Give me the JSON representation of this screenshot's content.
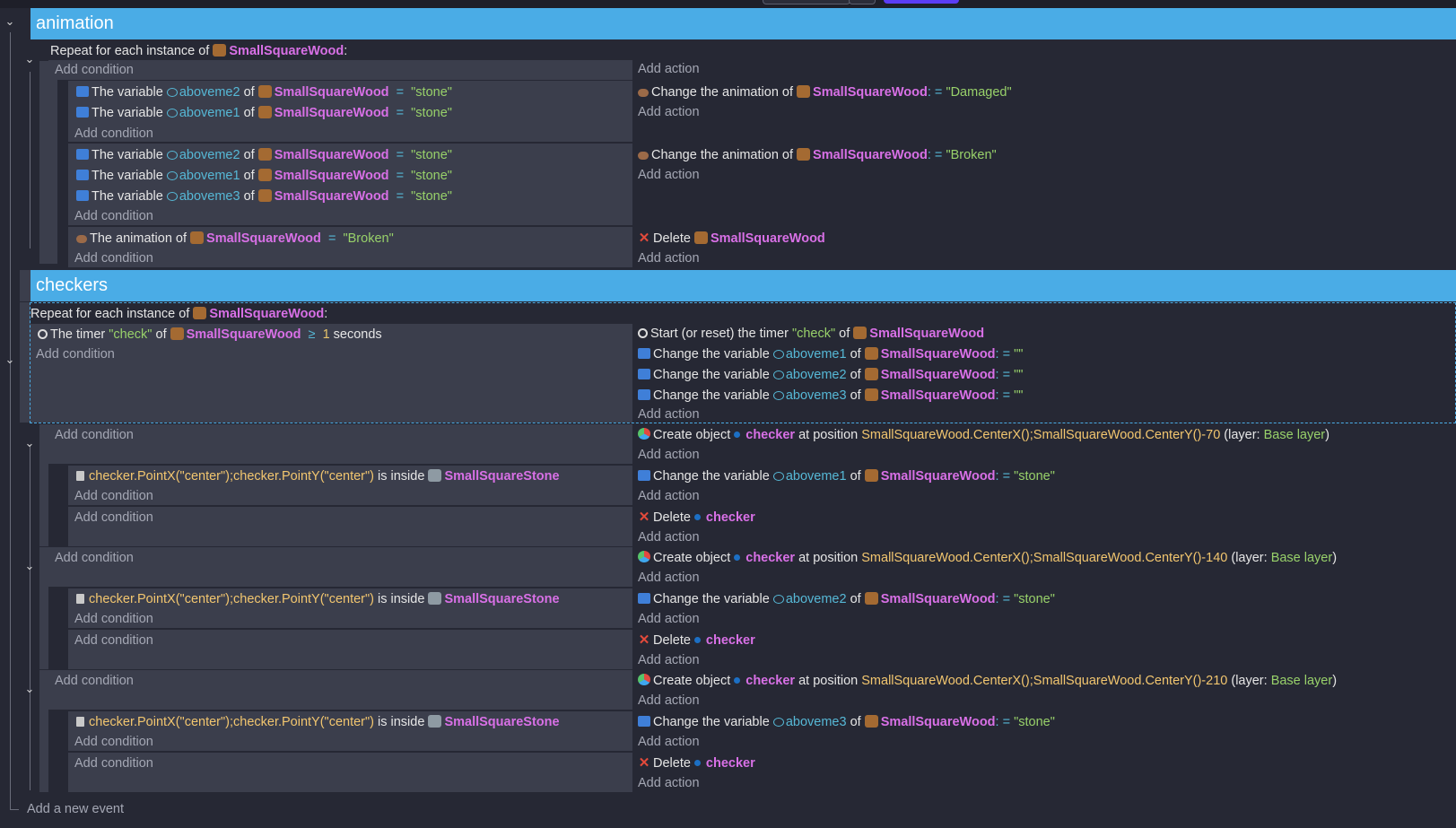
{
  "groups": {
    "animation": "animation",
    "checkers": "checkers"
  },
  "common": {
    "add_condition": "Add condition",
    "add_action": "Add action",
    "add_new_event": "Add a new event",
    "repeat_prefix": "Repeat for each instance of",
    "repeat_suffix": ":",
    "the_variable": "The variable",
    "of": "of",
    "eq": "=",
    "colon_eq": ": =",
    "change_anim_of": "Change the animation of",
    "the_anim_of": "The animation of",
    "delete": "Delete",
    "the_timer": "The timer",
    "ge": "≥",
    "seconds": "seconds",
    "start_timer": "Start (or reset) the timer",
    "change_variable": "Change the variable",
    "create_object": "Create object",
    "at_position": "at position",
    "layer_open": "(layer:",
    "layer_close": ")",
    "is_inside": "is inside"
  },
  "objects": {
    "wood": "SmallSquareWood",
    "stone": "SmallSquareStone",
    "checker": "checker"
  },
  "vars": {
    "a1": "aboveme1",
    "a2": "aboveme2",
    "a3": "aboveme3"
  },
  "strings": {
    "stone": "\"stone\"",
    "damaged": "\"Damaged\"",
    "broken": "\"Broken\"",
    "check": "\"check\"",
    "empty": "\"\"",
    "one": "1",
    "base_layer": "Base layer"
  },
  "expressions": {
    "pos70": "SmallSquareWood.CenterX();SmallSquareWood.CenterY()-70",
    "pos140": "SmallSquareWood.CenterX();SmallSquareWood.CenterY()-140",
    "pos210": "SmallSquareWood.CenterX();SmallSquareWood.CenterY()-210",
    "point": "checker.PointX(\"center\");checker.PointY(\"center\")"
  }
}
